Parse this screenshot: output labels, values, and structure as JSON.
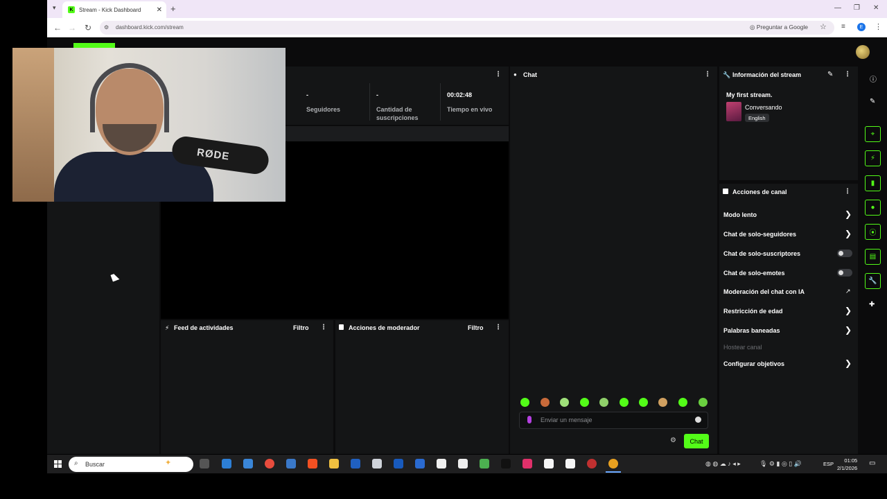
{
  "browser": {
    "tab_title": "Stream - Kick Dashboard",
    "tab_favicon_letter": "K",
    "url": "dashboard.kick.com/stream",
    "ask_google": "Preguntar a Google",
    "profile_letter": "E"
  },
  "stats": [
    {
      "value": "-",
      "label": "Seguidores"
    },
    {
      "value": "-",
      "label": "Cantidad de suscripciones"
    },
    {
      "value": "00:02:48",
      "label": "Tiempo en vivo"
    }
  ],
  "panels": {
    "feed_title": "Feed de actividades",
    "feed_filter": "Filtro",
    "mod_title": "Acciones de moderador",
    "mod_filter": "Filtro",
    "chat_title": "Chat",
    "chat_placeholder": "Enviar un mensaje",
    "chat_send": "Chat",
    "info_title": "Información del stream",
    "stream_title": "My first stream.",
    "category": "Conversando",
    "language": "English",
    "actions_title": "Acciones de canal"
  },
  "channel_actions": [
    {
      "label": "Modo lento",
      "control": "chevron",
      "enabled": true
    },
    {
      "label": "Chat de solo-seguidores",
      "control": "chevron",
      "enabled": true
    },
    {
      "label": "Chat de solo-suscriptores",
      "control": "toggle",
      "enabled": true,
      "on": false
    },
    {
      "label": "Chat de solo-emotes",
      "control": "toggle",
      "enabled": true,
      "on": false
    },
    {
      "label": "Moderación del chat con IA",
      "control": "chart",
      "enabled": true
    },
    {
      "label": "Restricción de edad",
      "control": "chevron",
      "enabled": true
    },
    {
      "label": "Palabras baneadas",
      "control": "chevron",
      "enabled": true
    },
    {
      "label": "Hostear canal",
      "control": "none",
      "enabled": false
    },
    {
      "label": "Configurar objetivos",
      "control": "chevron",
      "enabled": true
    }
  ],
  "webcam": {
    "mic_brand": "RØDE"
  },
  "taskbar": {
    "search_placeholder": "Buscar",
    "language": "ESP",
    "time": "01:05",
    "date": "2/1/2026"
  },
  "colors": {
    "accent": "#53fc18",
    "panel": "#141516",
    "background": "#0b0b0c"
  }
}
